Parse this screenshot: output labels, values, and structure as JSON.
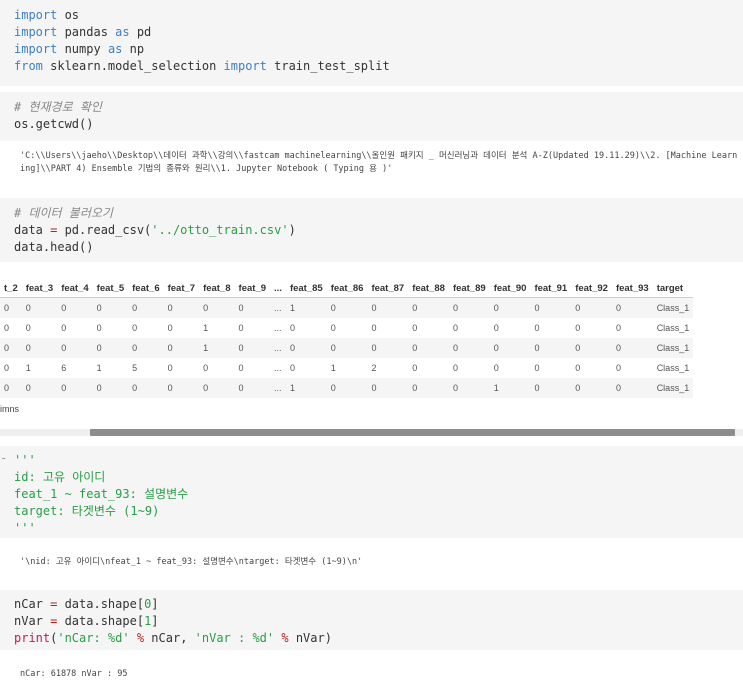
{
  "cell1": {
    "lines": [
      {
        "kw": "import",
        "rest": " os"
      },
      {
        "kw": "import",
        "rest": " pandas ",
        "kw2": "as",
        "rest2": " pd"
      },
      {
        "kw": "import",
        "rest": " numpy ",
        "kw2": "as",
        "rest2": " np"
      },
      {
        "kw": "from",
        "rest": " sklearn.model_selection ",
        "kw2": "import",
        "rest2": " train_test_split"
      }
    ]
  },
  "cell2": {
    "comment": "# 현재경로 확인",
    "code": "os.getcwd()"
  },
  "out2": "'C:\\\\Users\\\\jaeho\\\\Desktop\\\\데이터 과학\\\\강의\\\\fastcam machinelearning\\\\올인원 패키지 _ 머신러닝과 데이터 분석 A-Z(Updated 19.11.29)\\\\2. [Machine Learning]\\\\PART 4) Ensemble 기법의 종류와 원리\\\\1. Jupyter Notebook ( Typing 용 )'",
  "cell3": {
    "comment": "# 데이터 불러오기",
    "line1_a": "data ",
    "line1_op": "=",
    "line1_b": " pd.read_csv(",
    "line1_str": "'../otto_train.csv'",
    "line1_c": ")",
    "line2": "data.head()"
  },
  "dataframe": {
    "columns": [
      "t_2",
      "feat_3",
      "feat_4",
      "feat_5",
      "feat_6",
      "feat_7",
      "feat_8",
      "feat_9",
      "...",
      "feat_85",
      "feat_86",
      "feat_87",
      "feat_88",
      "feat_89",
      "feat_90",
      "feat_91",
      "feat_92",
      "feat_93",
      "target"
    ],
    "rows": [
      [
        "0",
        "0",
        "0",
        "0",
        "0",
        "0",
        "0",
        "0",
        "...",
        "1",
        "0",
        "0",
        "0",
        "0",
        "0",
        "0",
        "0",
        "0",
        "Class_1"
      ],
      [
        "0",
        "0",
        "0",
        "0",
        "0",
        "0",
        "1",
        "0",
        "...",
        "0",
        "0",
        "0",
        "0",
        "0",
        "0",
        "0",
        "0",
        "0",
        "Class_1"
      ],
      [
        "0",
        "0",
        "0",
        "0",
        "0",
        "0",
        "1",
        "0",
        "...",
        "0",
        "0",
        "0",
        "0",
        "0",
        "0",
        "0",
        "0",
        "0",
        "Class_1"
      ],
      [
        "0",
        "1",
        "6",
        "1",
        "5",
        "0",
        "0",
        "0",
        "...",
        "0",
        "1",
        "2",
        "0",
        "0",
        "0",
        "0",
        "0",
        "0",
        "Class_1"
      ],
      [
        "0",
        "0",
        "0",
        "0",
        "0",
        "0",
        "0",
        "0",
        "...",
        "1",
        "0",
        "0",
        "0",
        "0",
        "1",
        "0",
        "0",
        "0",
        "Class_1"
      ]
    ],
    "shape_note": "imns"
  },
  "cell4": {
    "prompt_fragment": "-",
    "lines": [
      "'''",
      "id: 고유 아이디",
      "feat_1 ~ feat_93: 설명변수",
      "target: 타겟변수 (1~9)",
      "'''"
    ]
  },
  "out4": "'\\nid: 고유 아이디\\nfeat_1 ~ feat_93: 설명변수\\ntarget: 타겟변수 (1~9)\\n'",
  "cell5": {
    "l1_a": "nCar ",
    "l1_op": "=",
    "l1_b": " data.shape[",
    "l1_n": "0",
    "l1_c": "]",
    "l2_a": "nVar ",
    "l2_op": "=",
    "l2_b": " data.shape[",
    "l2_n": "1",
    "l2_c": "]",
    "l3_fn": "print",
    "l3_a": "(",
    "l3_s1": "'nCar: %d'",
    "l3_op1": " % ",
    "l3_b": "nCar, ",
    "l3_s2": "'nVar : %d'",
    "l3_op2": " % ",
    "l3_c": "nVar)"
  },
  "out5": "nCar: 61878 nVar : 95"
}
